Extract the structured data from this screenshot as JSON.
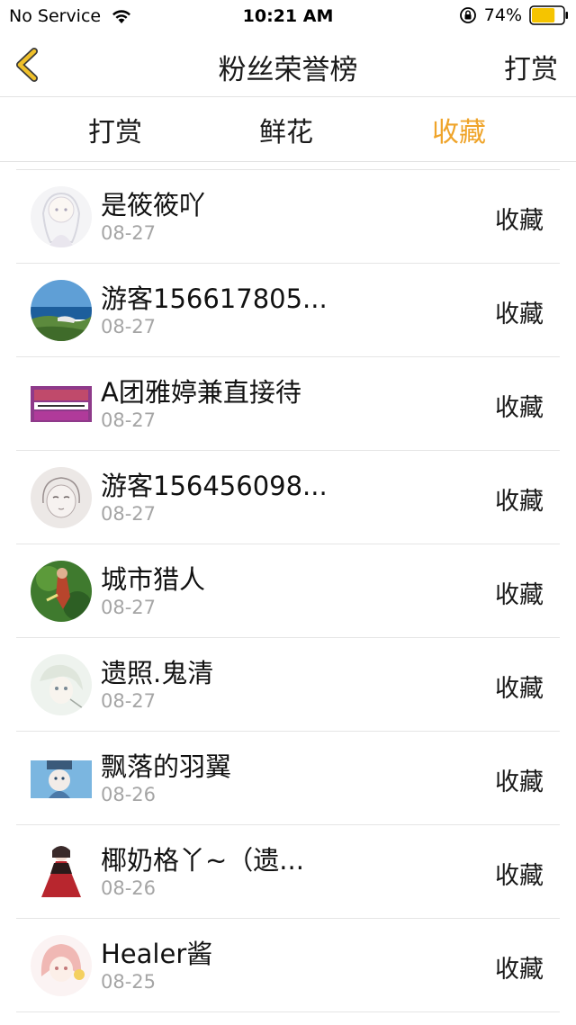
{
  "status_bar": {
    "carrier": "No Service",
    "time": "10:21 AM",
    "battery_pct": "74%",
    "battery_level": 0.74,
    "battery_color": "#f5c400"
  },
  "nav": {
    "title": "粉丝荣誉榜",
    "right_label": "打赏",
    "back_icon": "chevron-left-icon",
    "accent": "#efa42a"
  },
  "tabs": [
    {
      "label": "打赏",
      "active": false
    },
    {
      "label": "鲜花",
      "active": false
    },
    {
      "label": "收藏",
      "active": true
    }
  ],
  "list": [
    {
      "name": "是筱筱吖",
      "date": "08-27",
      "action": "收藏",
      "avatar": "anime-girl-avatar"
    },
    {
      "name": "游客156617805...",
      "date": "08-27",
      "action": "收藏",
      "avatar": "seascape-avatar"
    },
    {
      "name": "A团雅婷兼直接待",
      "date": "08-27",
      "action": "收藏",
      "avatar": "banner-avatar"
    },
    {
      "name": "游客156456098...",
      "date": "08-27",
      "action": "收藏",
      "avatar": "sketch-avatar"
    },
    {
      "name": "城市猎人",
      "date": "08-27",
      "action": "收藏",
      "avatar": "game-avatar"
    },
    {
      "name": "遗照.鬼清",
      "date": "08-27",
      "action": "收藏",
      "avatar": "pale-anime-avatar"
    },
    {
      "name": "飘落的羽翼",
      "date": "08-26",
      "action": "收藏",
      "avatar": "blue-anime-avatar"
    },
    {
      "name": "椰奶格丫~（遗...",
      "date": "08-26",
      "action": "收藏",
      "avatar": "red-dress-avatar"
    },
    {
      "name": "Healer酱",
      "date": "08-25",
      "action": "收藏",
      "avatar": "pink-hair-avatar"
    }
  ]
}
